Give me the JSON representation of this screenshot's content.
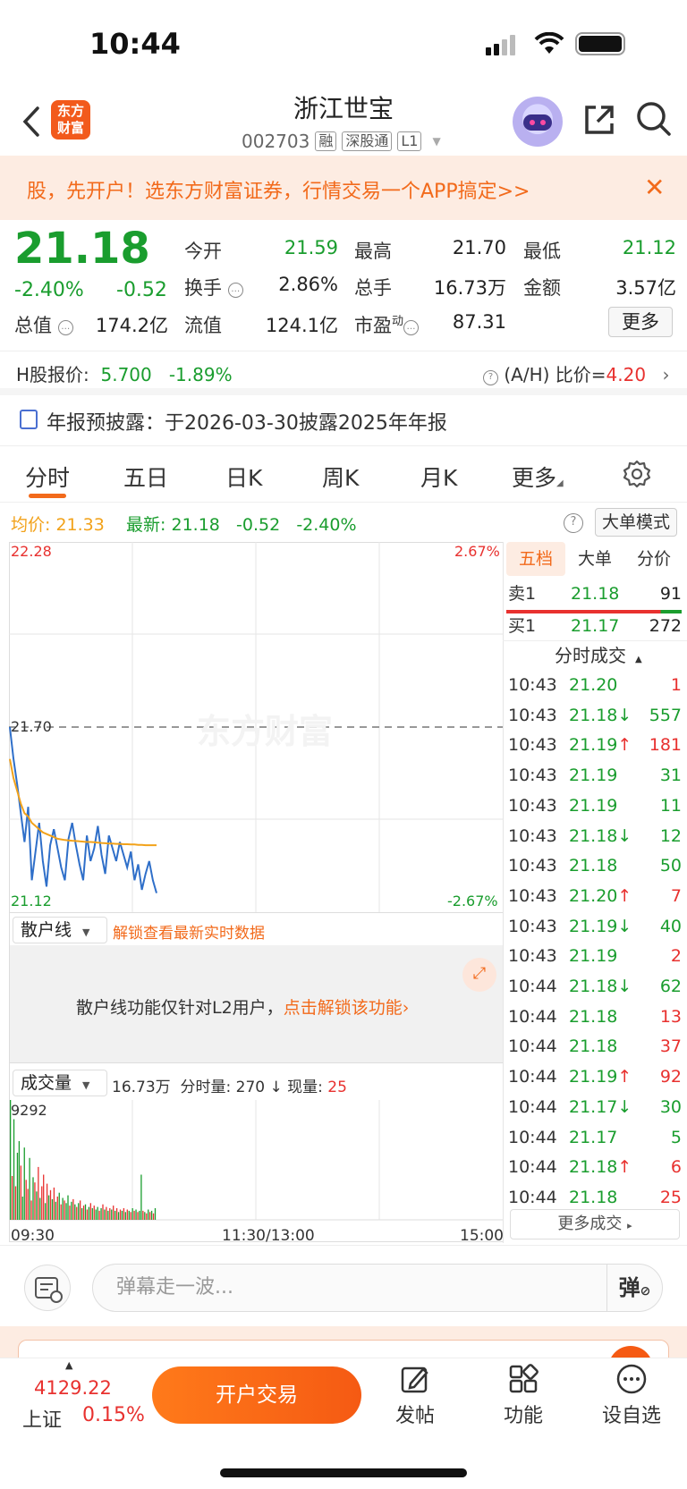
{
  "status_bar": {
    "time": "10:44"
  },
  "header": {
    "logo_text": "东方\n财富",
    "stock_name": "浙江世宝",
    "stock_code": "002703",
    "tags": [
      "融",
      "深股通",
      "L1"
    ]
  },
  "banner": {
    "text": "股，先开户！选东方财富证券，行情交易一个APP搞定>>"
  },
  "quote": {
    "price": "21.18",
    "change_pct": "-2.40%",
    "change": "-0.52",
    "open_label": "今开",
    "open": "21.59",
    "high_label": "最高",
    "high": "21.70",
    "low_label": "最低",
    "low": "21.12",
    "turnover_label": "换手",
    "turnover": "2.86%",
    "volume_label": "总手",
    "volume": "16.73万",
    "amount_label": "金额",
    "amount": "3.57亿",
    "mktcap_label": "总值",
    "mktcap": "174.2亿",
    "float_label": "流值",
    "float": "124.1亿",
    "pe_label": "市盈",
    "pe_sup": "动",
    "pe": "87.31",
    "more_label": "更多"
  },
  "hshare": {
    "label": "H股报价:",
    "price": "5.700",
    "change": "-1.89%",
    "ratio_label": "(A/H) 比价=",
    "ratio": "4.20"
  },
  "notice": {
    "text": "年报预披露：于2026-03-30披露2025年年报"
  },
  "tabs": [
    "分时",
    "五日",
    "日K",
    "周K",
    "月K",
    "更多"
  ],
  "avg_row": {
    "avg_label": "均价:",
    "avg": "21.33",
    "last_label": "最新:",
    "last": "21.18",
    "chg": "-0.52",
    "pct": "-2.40%",
    "bigorder_label": "大单模式"
  },
  "chart": {
    "top_price": "22.28",
    "top_pct": "2.67%",
    "mid_price": "21.70",
    "bottom_price": "21.12",
    "bottom_pct": "-2.67%",
    "retail_selector": "散户线",
    "retail_unlock": "解锁查看最新实时数据",
    "retail_notice": "散户线功能仅针对L2用户，",
    "retail_notice_link": "点击解锁该功能",
    "volume_selector": "成交量",
    "volume_total": "16.73万",
    "vol_minute_label": "分时量:",
    "vol_minute": "270",
    "vol_now_label": "现量:",
    "vol_now": "25",
    "vol_max": "9292",
    "time_start": "09:30",
    "time_mid": "11:30/13:00",
    "time_end": "15:00"
  },
  "chart_data": {
    "type": "line",
    "ylim": [
      21.12,
      22.28
    ],
    "series": [
      {
        "name": "",
        "values": [
          21.7,
          21.6,
          21.52,
          21.43,
          21.34,
          21.45,
          21.22,
          21.31,
          21.4,
          21.28,
          21.2,
          21.33,
          21.38,
          21.32,
          21.26,
          21.22,
          21.35,
          21.4,
          21.33,
          21.27,
          21.22,
          21.36,
          21.28,
          21.32,
          21.39,
          21.3,
          21.24,
          21.36,
          21.32,
          21.28,
          21.34,
          21.3,
          21.26,
          21.31,
          21.22,
          21.27,
          21.19,
          21.24,
          21.28,
          21.22,
          21.18
        ]
      },
      {
        "name": "",
        "values": [
          21.6,
          21.54,
          21.5,
          21.46,
          21.43,
          21.42,
          21.4,
          21.39,
          21.38,
          21.37,
          21.365,
          21.36,
          21.355,
          21.35,
          21.348,
          21.346,
          21.345,
          21.344,
          21.343,
          21.342,
          21.341,
          21.34,
          21.34,
          21.339,
          21.338,
          21.337,
          21.336,
          21.335,
          21.335,
          21.334,
          21.334,
          21.333,
          21.333,
          21.332,
          21.332,
          21.331,
          21.331,
          21.33,
          21.33,
          21.33,
          21.33
        ]
      }
    ],
    "volume": {
      "max": 9292,
      "bars": [
        9292,
        3400,
        7800,
        2600,
        5200,
        6100,
        4200,
        1800,
        5600,
        3100,
        2400,
        4800,
        1500,
        3300,
        2900,
        2200,
        4100,
        1700,
        2600,
        3500,
        1300,
        2800,
        1900,
        2300,
        1600,
        2500,
        1400,
        1800,
        2100,
        1200,
        1700,
        1500,
        1300,
        1900,
        1100,
        1400,
        1600,
        1200,
        1000,
        1300,
        1500,
        900,
        1100,
        1200,
        800,
        1000,
        1300,
        900,
        1100,
        800,
        1000,
        700,
        900,
        1200,
        800,
        1000,
        700,
        900,
        800,
        1100,
        700,
        900,
        600,
        800,
        700,
        900,
        600,
        800,
        700,
        600,
        900,
        700,
        800,
        600,
        700,
        3500,
        700,
        600,
        500,
        800,
        600,
        700,
        500,
        900
      ],
      "colors": [
        "g",
        "r",
        "g",
        "r",
        "g",
        "g",
        "r",
        "g",
        "g",
        "r",
        "r",
        "g",
        "r",
        "g",
        "r",
        "g",
        "r",
        "g",
        "r",
        "r",
        "g",
        "r",
        "g",
        "r",
        "g",
        "r",
        "g",
        "r",
        "g",
        "r",
        "g",
        "r",
        "g",
        "g",
        "r",
        "g",
        "r",
        "g",
        "r",
        "g",
        "r",
        "g",
        "r",
        "g",
        "r",
        "g",
        "r",
        "g",
        "r",
        "g",
        "g",
        "r",
        "g",
        "r",
        "g",
        "r",
        "g",
        "r",
        "g",
        "r",
        "g",
        "r",
        "g",
        "r",
        "g",
        "r",
        "g",
        "r",
        "g",
        "r",
        "g",
        "r",
        "g",
        "r",
        "g",
        "g",
        "r",
        "g",
        "r",
        "g",
        "r",
        "g",
        "r",
        "g"
      ]
    }
  },
  "right_panel": {
    "tabs": [
      "五档",
      "大单",
      "分价"
    ],
    "sell1": {
      "label": "卖1",
      "price": "21.18",
      "vol": "91"
    },
    "buy1": {
      "label": "买1",
      "price": "21.17",
      "vol": "272"
    },
    "trades_title": "分时成交",
    "trades": [
      {
        "time": "10:43",
        "price": "21.20",
        "arrow": "",
        "vol": "1",
        "pc": "green",
        "vc": "red"
      },
      {
        "time": "10:43",
        "price": "21.18",
        "arrow": "↓",
        "vol": "557",
        "pc": "green",
        "vc": "green"
      },
      {
        "time": "10:43",
        "price": "21.19",
        "arrow": "↑",
        "vol": "181",
        "pc": "green",
        "vc": "red"
      },
      {
        "time": "10:43",
        "price": "21.19",
        "arrow": "",
        "vol": "31",
        "pc": "green",
        "vc": "green"
      },
      {
        "time": "10:43",
        "price": "21.19",
        "arrow": "",
        "vol": "11",
        "pc": "green",
        "vc": "green"
      },
      {
        "time": "10:43",
        "price": "21.18",
        "arrow": "↓",
        "vol": "12",
        "pc": "green",
        "vc": "green"
      },
      {
        "time": "10:43",
        "price": "21.18",
        "arrow": "",
        "vol": "50",
        "pc": "green",
        "vc": "green"
      },
      {
        "time": "10:43",
        "price": "21.20",
        "arrow": "↑",
        "vol": "7",
        "pc": "green",
        "vc": "red"
      },
      {
        "time": "10:43",
        "price": "21.19",
        "arrow": "↓",
        "vol": "40",
        "pc": "green",
        "vc": "green"
      },
      {
        "time": "10:43",
        "price": "21.19",
        "arrow": "",
        "vol": "2",
        "pc": "green",
        "vc": "red"
      },
      {
        "time": "10:44",
        "price": "21.18",
        "arrow": "↓",
        "vol": "62",
        "pc": "green",
        "vc": "green"
      },
      {
        "time": "10:44",
        "price": "21.18",
        "arrow": "",
        "vol": "13",
        "pc": "green",
        "vc": "red"
      },
      {
        "time": "10:44",
        "price": "21.18",
        "arrow": "",
        "vol": "37",
        "pc": "green",
        "vc": "red"
      },
      {
        "time": "10:44",
        "price": "21.19",
        "arrow": "↑",
        "vol": "92",
        "pc": "green",
        "vc": "red"
      },
      {
        "time": "10:44",
        "price": "21.17",
        "arrow": "↓",
        "vol": "30",
        "pc": "green",
        "vc": "green"
      },
      {
        "time": "10:44",
        "price": "21.17",
        "arrow": "",
        "vol": "5",
        "pc": "green",
        "vc": "green"
      },
      {
        "time": "10:44",
        "price": "21.18",
        "arrow": "↑",
        "vol": "6",
        "pc": "green",
        "vc": "red"
      },
      {
        "time": "10:44",
        "price": "21.18",
        "arrow": "",
        "vol": "25",
        "pc": "green",
        "vc": "red"
      }
    ],
    "more_trades": "更多成交"
  },
  "danmaku": {
    "placeholder": "弹幕走一波...",
    "send": "弹"
  },
  "bottom_nav": {
    "index_value": "4129.22",
    "index_name": "上证",
    "index_pct": "0.15%",
    "open_trade": "开户交易",
    "items": [
      "发帖",
      "功能",
      "设自选"
    ]
  },
  "colors": {
    "red": "#e8312f",
    "green": "#1a9d2e",
    "orange": "#f26a1b",
    "line_blue": "#2f6fc9",
    "avg_orange": "#f2a21a"
  }
}
